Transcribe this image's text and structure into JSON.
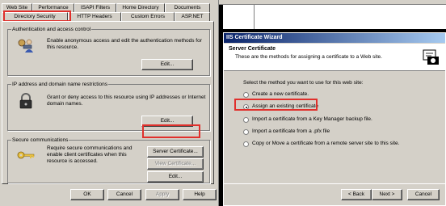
{
  "properties": {
    "tabs_back": [
      "Web Site",
      "Performance",
      "ISAPI Filters",
      "Home Directory",
      "Documents"
    ],
    "tabs_front": [
      "Directory Security",
      "HTTP Headers",
      "Custom Errors",
      "ASP.NET"
    ],
    "groups": {
      "auth": {
        "title": "Authentication and access control",
        "text": "Enable anonymous access and edit the authentication methods for this resource.",
        "edit": "Edit..."
      },
      "ip": {
        "title": "IP address and domain name restrictions",
        "text": "Grant or deny access to this resource using IP addresses or Internet domain names.",
        "edit": "Edit..."
      },
      "secure": {
        "title": "Secure communications",
        "text": "Require secure communications and enable client certificates when this resource is accessed.",
        "server_cert": "Server Certificate...",
        "view_cert": "View Certificate...",
        "edit": "Edit..."
      }
    },
    "footer": {
      "ok": "OK",
      "cancel": "Cancel",
      "apply": "Apply",
      "help": "Help"
    }
  },
  "wizard": {
    "title": "IIS Certificate Wizard",
    "header_title": "Server Certificate",
    "header_sub": "These are the methods for assigning a certificate to a Web site.",
    "prompt": "Select the method you want to use for this web site:",
    "options": [
      "Create a new certificate.",
      "Assign an existing certificate",
      "Import a certificate from a Key Manager backup file.",
      "Import a certificate from a .pfx file",
      "Copy or Move a certificate from a remote server site to this site."
    ],
    "selected_option": 1,
    "footer": {
      "back": "< Back",
      "next": "Next >",
      "cancel": "Cancel"
    }
  }
}
